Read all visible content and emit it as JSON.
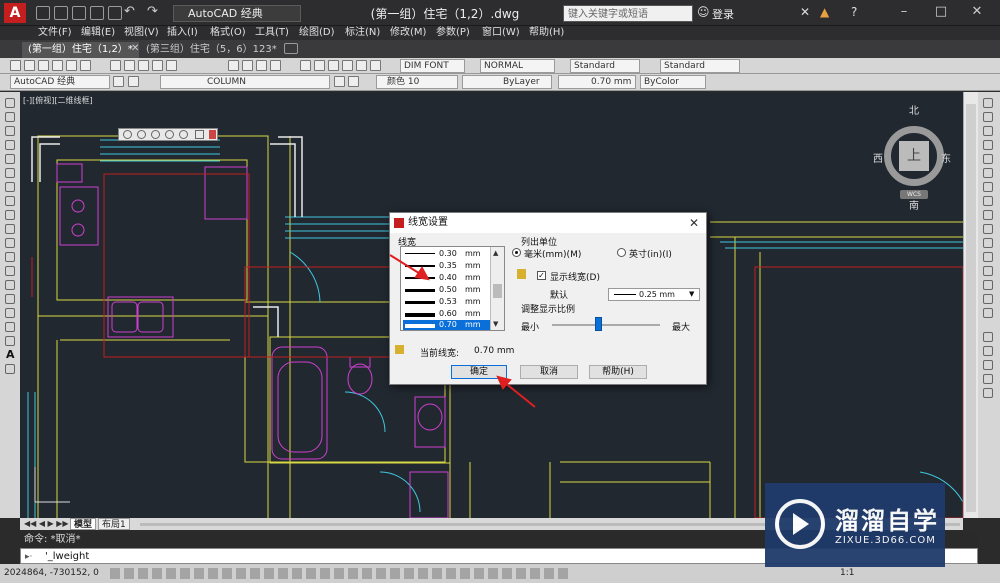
{
  "titlebar": {
    "workspace": "AutoCAD 经典",
    "document_title": "(第一组）住宅（1,2）.dwg",
    "search_placeholder": "键入关键字或短语",
    "login": "登录"
  },
  "menu": [
    "文件(F)",
    "编辑(E)",
    "视图(V)",
    "插入(I)",
    "格式(O)",
    "工具(T)",
    "绘图(D)",
    "标注(N)",
    "修改(M)",
    "参数(P)",
    "窗口(W)",
    "帮助(H)"
  ],
  "tabs": [
    "(第一组）住宅（1,2）*",
    "(第三组）住宅（5，6）123*"
  ],
  "toolbar1": {
    "dim_style": "DIM FONT",
    "table_style": "NORMAL",
    "text_style": "Standard",
    "multileader_style": "Standard"
  },
  "toolbar2": {
    "workspace": "AutoCAD 经典",
    "layer": "COLUMN",
    "color": "颜色 10",
    "linetype": "ByLayer",
    "lineweight": "0.70 mm",
    "plotstyle": "ByColor"
  },
  "viewport_label": "[-][俯视][二维线框]",
  "viewcube": {
    "north": "北",
    "south": "南",
    "east": "东",
    "west": "西",
    "top": "上",
    "wcs": "WCS"
  },
  "dialog": {
    "title": "线宽设置",
    "lineweights_label": "线宽",
    "lineweights": [
      {
        "value": "0.30",
        "unit": "mm"
      },
      {
        "value": "0.35",
        "unit": "mm"
      },
      {
        "value": "0.40",
        "unit": "mm"
      },
      {
        "value": "0.50",
        "unit": "mm"
      },
      {
        "value": "0.53",
        "unit": "mm"
      },
      {
        "value": "0.60",
        "unit": "mm"
      },
      {
        "value": "0.70",
        "unit": "mm"
      }
    ],
    "units_label": "列出单位",
    "unit_mm": "毫米(mm)(M)",
    "unit_in": "英寸(in)(I)",
    "display_lw": "显示线宽(D)",
    "default_label": "默认",
    "default_value": "0.25 mm",
    "scale_label": "调整显示比例",
    "min_label": "最小",
    "max_label": "最大",
    "current_label": "当前线宽:",
    "current_value": "0.70 mm",
    "ok": "确定",
    "cancel": "取消",
    "help": "帮助(H)"
  },
  "layout_tabs": [
    "模型",
    "布局1"
  ],
  "command": {
    "history": "命令: *取消*",
    "input": "'_lweight"
  },
  "status": {
    "coords": "2024864, -730152, 0",
    "scale": "1:1"
  },
  "watermark": {
    "brand": "溜溜自学",
    "url": "ZIXUE.3D66.COM"
  }
}
